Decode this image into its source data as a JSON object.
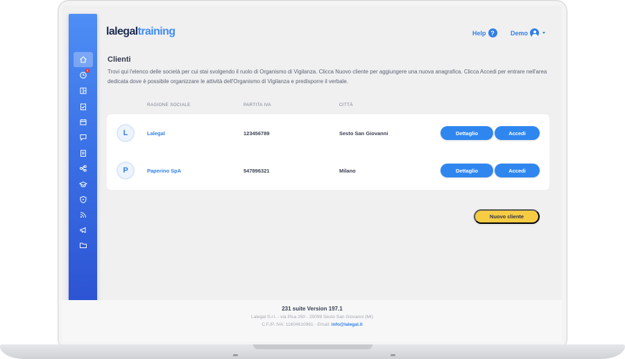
{
  "header": {
    "logo_part1": "lalegal",
    "logo_part2": "training",
    "help_label": "Help",
    "help_icon_glyph": "?",
    "user_label": "Demo"
  },
  "sidebar": {
    "items": [
      {
        "icon": "home-icon",
        "active": true
      },
      {
        "icon": "clock-icon",
        "badge": "1"
      },
      {
        "icon": "layout-icon"
      },
      {
        "icon": "clipboard-check-icon"
      },
      {
        "icon": "calendar-icon"
      },
      {
        "icon": "chat-icon"
      },
      {
        "icon": "clipboard-list-icon"
      },
      {
        "icon": "flow-icon"
      },
      {
        "icon": "graduation-cap-icon"
      },
      {
        "icon": "shield-icon"
      },
      {
        "icon": "rss-icon"
      },
      {
        "icon": "megaphone-icon"
      },
      {
        "icon": "folder-icon"
      }
    ]
  },
  "main": {
    "title": "Clienti",
    "description": "Trovi qui l'elenco delle società per cui stai svolgendo il ruolo di Organismo di Vigilanza. Clicca Nuovo cliente per aggiungere una nuova anagrafica. Clicca Accedi per entrare nell'area dedicata dove è possibile organizzare le attività dell'Organismo di Vigilanza e predisporre il verbale.",
    "columns": [
      "RAGIONE SOCIALE",
      "PARTITA IVA",
      "CITTÀ"
    ],
    "rows": [
      {
        "initial": "L",
        "name": "Lalegal",
        "piva": "123456789",
        "city": "Sesto San Giovanni",
        "detail_label": "Dettaglio",
        "access_label": "Accedi"
      },
      {
        "initial": "P",
        "name": "Paperino SpA",
        "piva": "547896321",
        "city": "Milano",
        "detail_label": "Dettaglio",
        "access_label": "Accedi"
      }
    ],
    "new_client_label": "Nuovo cliente"
  },
  "footer": {
    "version": "231 suite Version 197.1",
    "address": "Lalegal S.r.l. - via Pisa 250 - 20099 Sesto San Giovanni (MI)",
    "fiscal_prefix": "C.F./P. IVA: 11604610961 - Email:",
    "email": "info@lalegal.it"
  },
  "colors": {
    "accent": "#2f86ef",
    "sidebar_top": "#4e8ef5",
    "sidebar_bottom": "#2a4fd0",
    "cta_yellow": "#f6cc45",
    "badge_red": "#e8333b"
  }
}
